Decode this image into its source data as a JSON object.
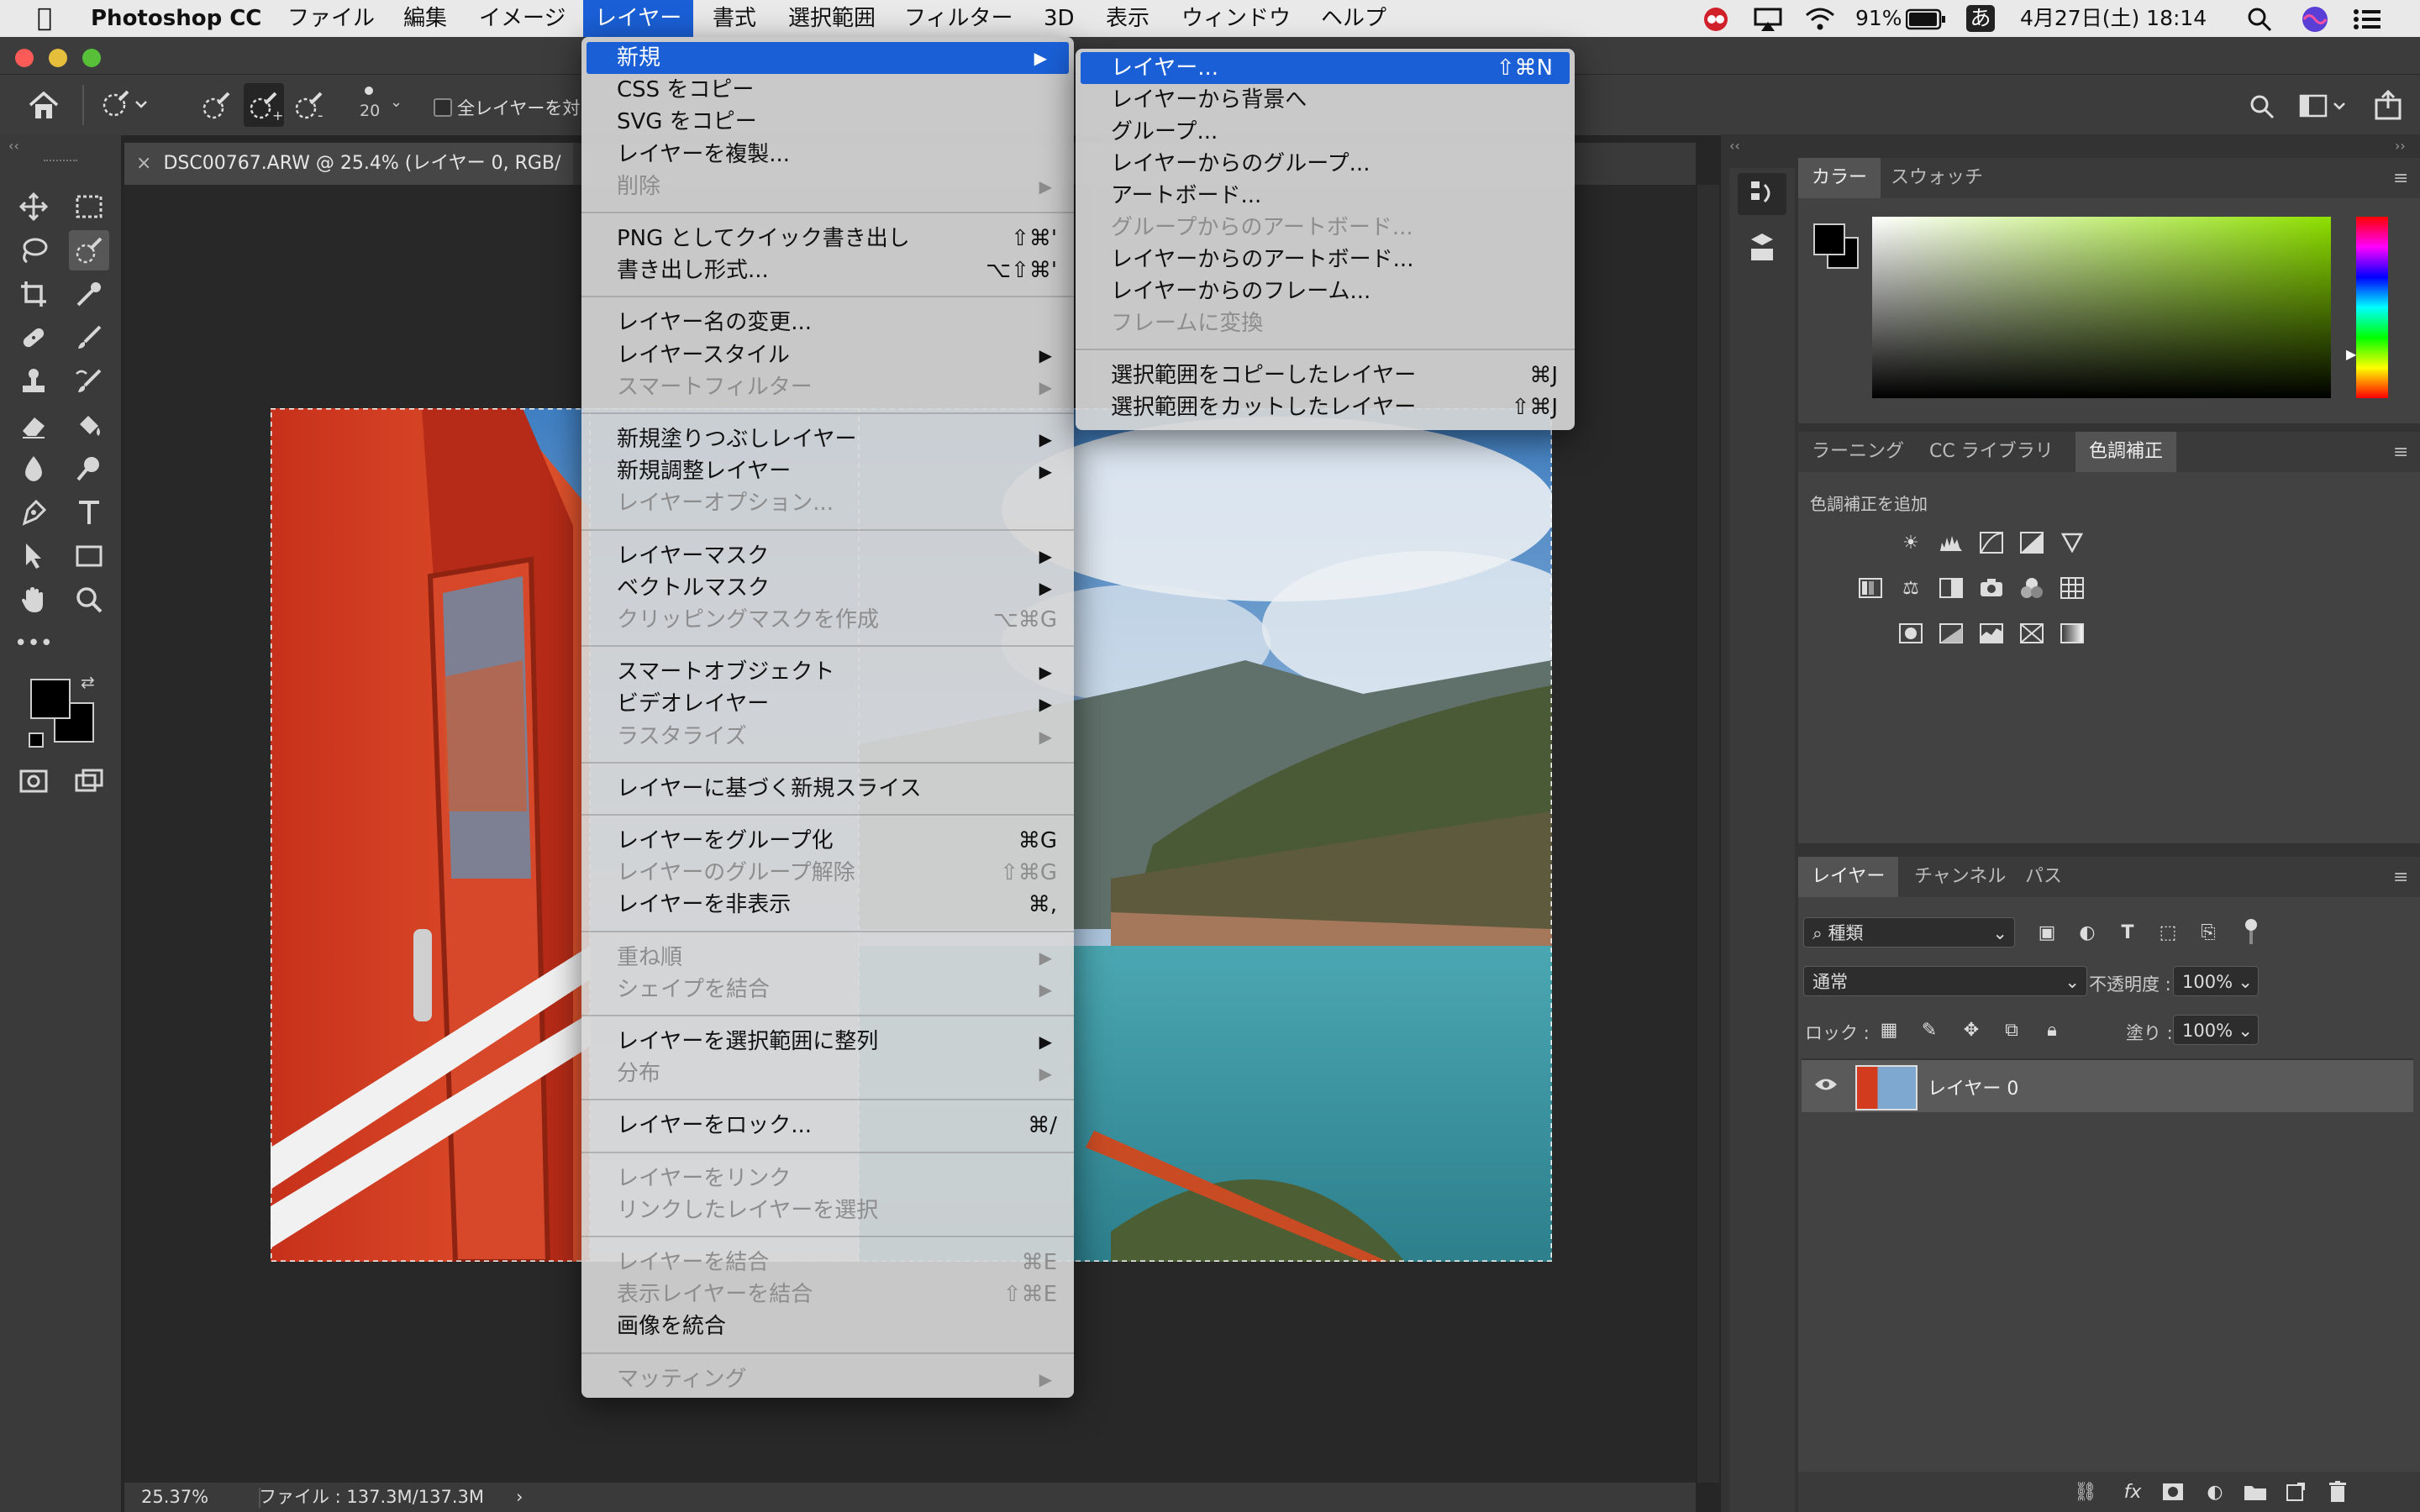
{
  "menubar": {
    "app_name": "Photoshop CC",
    "items": [
      "ファイル",
      "編集",
      "イメージ",
      "レイヤー",
      "書式",
      "選択範囲",
      "フィルター",
      "3D",
      "表示",
      "ウィンドウ",
      "ヘルプ"
    ],
    "battery": "91%",
    "input_method": "あ",
    "clock": "4月27日(土)  18:14"
  },
  "options_bar": {
    "brush_size": "20",
    "all_layers_label": "全レイヤーを対"
  },
  "document": {
    "tab_title": "DSC00767.ARW @ 25.4% (レイヤー 0, RGB/",
    "zoom": "25.37%",
    "file_info": "ファイル : 137.3M/137.3M"
  },
  "layer_menu": {
    "groups": [
      [
        {
          "label": "新規",
          "arrow": true,
          "highlight": true
        },
        {
          "label": "CSS をコピー"
        },
        {
          "label": "SVG をコピー"
        },
        {
          "label": "レイヤーを複製..."
        },
        {
          "label": "削除",
          "arrow": true,
          "disabled": true
        }
      ],
      [
        {
          "label": "PNG としてクイック書き出し",
          "shortcut": "⇧⌘'"
        },
        {
          "label": "書き出し形式...",
          "shortcut": "⌥⇧⌘'"
        }
      ],
      [
        {
          "label": "レイヤー名の変更..."
        },
        {
          "label": "レイヤースタイル",
          "arrow": true
        },
        {
          "label": "スマートフィルター",
          "arrow": true,
          "disabled": true
        }
      ],
      [
        {
          "label": "新規塗りつぶしレイヤー",
          "arrow": true
        },
        {
          "label": "新規調整レイヤー",
          "arrow": true
        },
        {
          "label": "レイヤーオプション...",
          "disabled": true
        }
      ],
      [
        {
          "label": "レイヤーマスク",
          "arrow": true
        },
        {
          "label": "ベクトルマスク",
          "arrow": true
        },
        {
          "label": "クリッピングマスクを作成",
          "shortcut": "⌥⌘G",
          "disabled": true
        }
      ],
      [
        {
          "label": "スマートオブジェクト",
          "arrow": true
        },
        {
          "label": "ビデオレイヤー",
          "arrow": true
        },
        {
          "label": "ラスタライズ",
          "arrow": true,
          "disabled": true
        }
      ],
      [
        {
          "label": "レイヤーに基づく新規スライス"
        }
      ],
      [
        {
          "label": "レイヤーをグループ化",
          "shortcut": "⌘G"
        },
        {
          "label": "レイヤーのグループ解除",
          "shortcut": "⇧⌘G",
          "disabled": true
        },
        {
          "label": "レイヤーを非表示",
          "shortcut": "⌘,"
        }
      ],
      [
        {
          "label": "重ね順",
          "arrow": true,
          "disabled": true
        },
        {
          "label": "シェイプを結合",
          "arrow": true,
          "disabled": true
        }
      ],
      [
        {
          "label": "レイヤーを選択範囲に整列",
          "arrow": true
        },
        {
          "label": "分布",
          "arrow": true,
          "disabled": true
        }
      ],
      [
        {
          "label": "レイヤーをロック...",
          "shortcut": "⌘/"
        }
      ],
      [
        {
          "label": "レイヤーをリンク",
          "disabled": true
        },
        {
          "label": "リンクしたレイヤーを選択",
          "disabled": true
        }
      ],
      [
        {
          "label": "レイヤーを結合",
          "shortcut": "⌘E",
          "disabled": true
        },
        {
          "label": "表示レイヤーを結合",
          "shortcut": "⇧⌘E",
          "disabled": true
        },
        {
          "label": "画像を統合"
        }
      ],
      [
        {
          "label": "マッティング",
          "arrow": true,
          "disabled": true
        }
      ]
    ]
  },
  "new_submenu": {
    "groups": [
      [
        {
          "label": "レイヤー...",
          "shortcut": "⇧⌘N",
          "highlight": true
        },
        {
          "label": "レイヤーから背景へ"
        },
        {
          "label": "グループ..."
        },
        {
          "label": "レイヤーからのグループ..."
        },
        {
          "label": "アートボード..."
        },
        {
          "label": "グループからのアートボード...",
          "disabled": true
        },
        {
          "label": "レイヤーからのアートボード..."
        },
        {
          "label": "レイヤーからのフレーム..."
        },
        {
          "label": "フレームに変換",
          "disabled": true
        }
      ],
      [
        {
          "label": "選択範囲をコピーしたレイヤー",
          "shortcut": "⌘J"
        },
        {
          "label": "選択範囲をカットしたレイヤー",
          "shortcut": "⇧⌘J"
        }
      ]
    ]
  },
  "color_panel": {
    "tabs": [
      "カラー",
      "スウォッチ"
    ],
    "active": 0,
    "spectrum_accent": "#8ee000"
  },
  "adjust_panel": {
    "tabs": [
      "ラーニング",
      "CC ライブラリ",
      "色調補正"
    ],
    "active": 2,
    "add_label": "色調補正を追加"
  },
  "layers_panel": {
    "tabs": [
      "レイヤー",
      "チャンネル",
      "パス"
    ],
    "active": 0,
    "filter_kind": "種類",
    "blend_mode": "通常",
    "opacity_label": "不透明度 :",
    "opacity_value": "100%",
    "lock_label": "ロック :",
    "fill_label": "塗り :",
    "fill_value": "100%",
    "layer_name": "レイヤー 0"
  }
}
